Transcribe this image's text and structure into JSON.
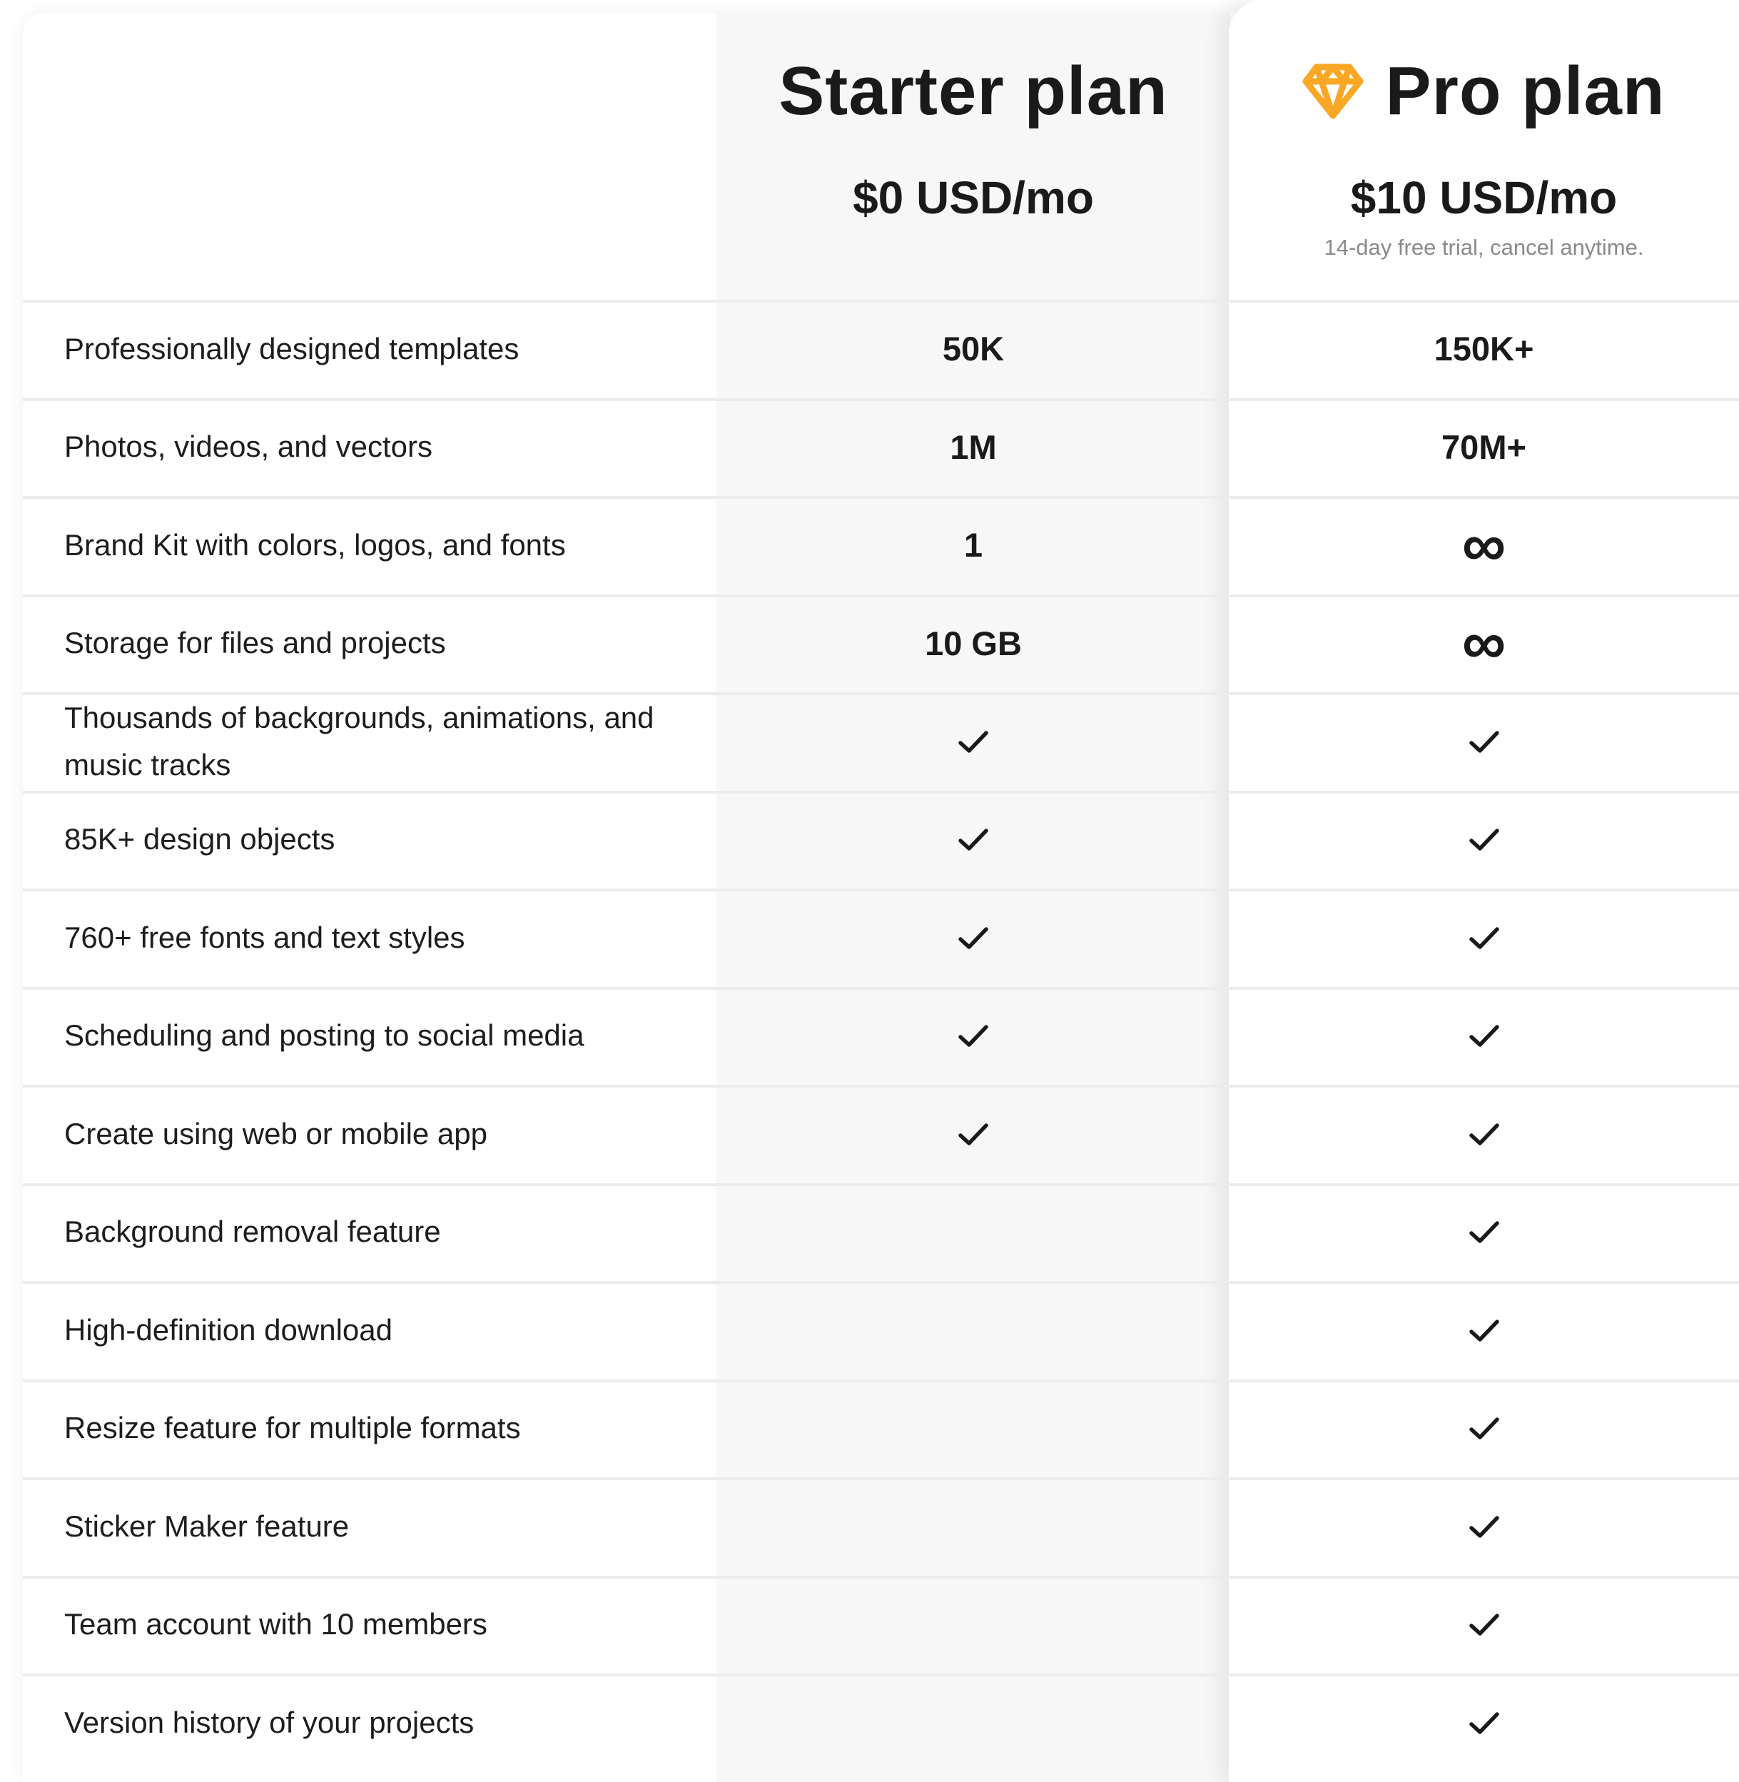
{
  "plans": {
    "starter": {
      "name": "Starter plan",
      "price": "$0 USD/mo"
    },
    "pro": {
      "name": "Pro plan",
      "price": "$10 USD/mo",
      "note": "14-day free trial, cancel anytime.",
      "icon": "diamond-icon",
      "icon_color": "#F9A825"
    }
  },
  "icons": {
    "check": "check-icon",
    "infinity": "infinity-symbol"
  },
  "rows": [
    {
      "feature": "Professionally designed templates",
      "starter": "50K",
      "pro": "150K+"
    },
    {
      "feature": "Photos, videos, and vectors",
      "starter": "1M",
      "pro": "70M+"
    },
    {
      "feature": "Brand Kit with colors, logos, and fonts",
      "starter": "1",
      "pro": "∞"
    },
    {
      "feature": "Storage for files and projects",
      "starter": "10 GB",
      "pro": "∞"
    },
    {
      "feature": "Thousands of backgrounds, animations, and music tracks",
      "starter": "check",
      "pro": "check"
    },
    {
      "feature": "85K+ design objects",
      "starter": "check",
      "pro": "check"
    },
    {
      "feature": "760+ free fonts and text styles",
      "starter": "check",
      "pro": "check"
    },
    {
      "feature": "Scheduling and posting to social media",
      "starter": "check",
      "pro": "check"
    },
    {
      "feature": "Create using web or mobile app",
      "starter": "check",
      "pro": "check"
    },
    {
      "feature": "Background removal feature",
      "starter": "",
      "pro": "check"
    },
    {
      "feature": "High-definition download",
      "starter": "",
      "pro": "check"
    },
    {
      "feature": "Resize feature for multiple formats",
      "starter": "",
      "pro": "check"
    },
    {
      "feature": "Sticker Maker feature",
      "starter": "",
      "pro": "check"
    },
    {
      "feature": "Team account with 10 members",
      "starter": "",
      "pro": "check"
    },
    {
      "feature": "Version history of your projects",
      "starter": "",
      "pro": "check"
    }
  ]
}
